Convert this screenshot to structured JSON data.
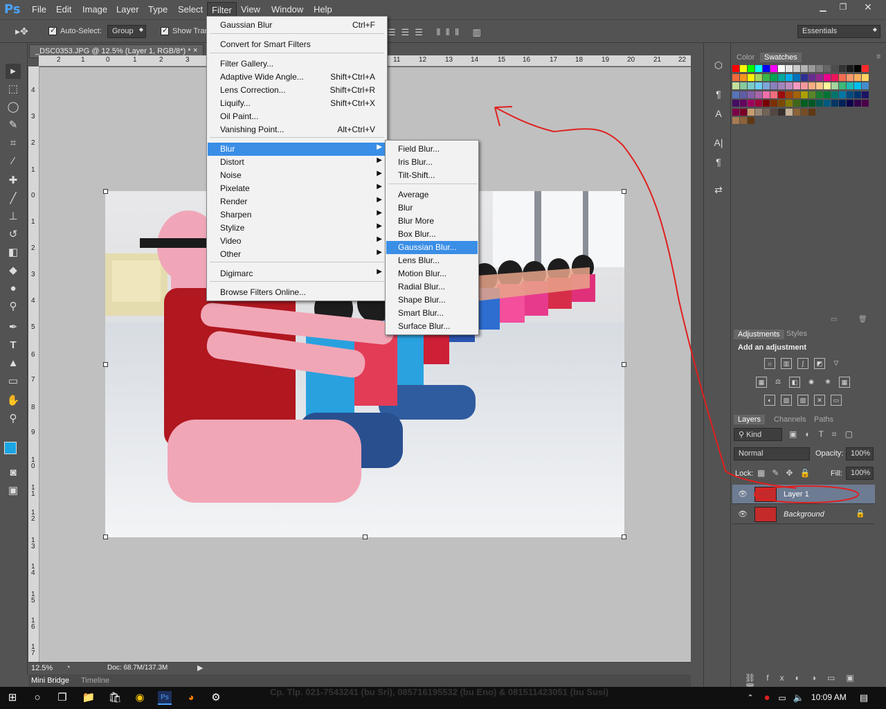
{
  "app": {
    "logo": "Ps"
  },
  "menu": [
    "File",
    "Edit",
    "Image",
    "Layer",
    "Type",
    "Select",
    "Filter",
    "View",
    "Window",
    "Help"
  ],
  "options": {
    "auto_select": "Auto-Select:",
    "group": "Group",
    "show_transform": "Show Tran",
    "workspace": "Essentials"
  },
  "document": {
    "tab_title": "_DSC0353.JPG @ 12.5% (Layer 1, RGB/8*) *",
    "close": "×"
  },
  "ruler_h": [
    "2",
    "1",
    "0",
    "1",
    "2",
    "3",
    "11",
    "12",
    "13",
    "14",
    "15",
    "16",
    "17",
    "18",
    "19",
    "20",
    "21",
    "22"
  ],
  "ruler_v": [
    "4",
    "3",
    "2",
    "1",
    "0",
    "1",
    "2",
    "3",
    "4",
    "5",
    "6",
    "7",
    "8",
    "9",
    "1 0",
    "1 1",
    "1 2",
    "1 3",
    "1 4",
    "1 5",
    "1 6",
    "1 7"
  ],
  "filter_menu": {
    "items": [
      {
        "label": "Gaussian Blur",
        "shortcut": "Ctrl+F"
      },
      {
        "label": "Convert for Smart Filters",
        "shortcut": ""
      },
      {
        "label": "Filter Gallery...",
        "shortcut": ""
      },
      {
        "label": "Adaptive Wide Angle...",
        "shortcut": "Shift+Ctrl+A"
      },
      {
        "label": "Lens Correction...",
        "shortcut": "Shift+Ctrl+R"
      },
      {
        "label": "Liquify...",
        "shortcut": "Shift+Ctrl+X"
      },
      {
        "label": "Oil Paint...",
        "shortcut": ""
      },
      {
        "label": "Vanishing Point...",
        "shortcut": "Alt+Ctrl+V"
      },
      {
        "label": "Blur",
        "shortcut": ""
      },
      {
        "label": "Distort",
        "shortcut": ""
      },
      {
        "label": "Noise",
        "shortcut": ""
      },
      {
        "label": "Pixelate",
        "shortcut": ""
      },
      {
        "label": "Render",
        "shortcut": ""
      },
      {
        "label": "Sharpen",
        "shortcut": ""
      },
      {
        "label": "Stylize",
        "shortcut": ""
      },
      {
        "label": "Video",
        "shortcut": ""
      },
      {
        "label": "Other",
        "shortcut": ""
      },
      {
        "label": "Digimarc",
        "shortcut": ""
      },
      {
        "label": "Browse Filters Online...",
        "shortcut": ""
      }
    ]
  },
  "blur_menu": [
    "Field Blur...",
    "Iris Blur...",
    "Tilt-Shift...",
    "Average",
    "Blur",
    "Blur More",
    "Box Blur...",
    "Gaussian Blur...",
    "Lens Blur...",
    "Motion Blur...",
    "Radial Blur...",
    "Shape Blur...",
    "Smart Blur...",
    "Surface Blur..."
  ],
  "status": {
    "zoom": "12.5%",
    "doc": "Doc: 68.7M/137.3M"
  },
  "bottom_tabs": [
    "Mini Bridge",
    "Timeline"
  ],
  "panels": {
    "color_tabs": [
      "Color",
      "Swatches"
    ],
    "adjust_tabs": [
      "Adjustments",
      "Styles"
    ],
    "add_adjustment": "Add an adjustment",
    "layer_tabs": [
      "Layers",
      "Channels",
      "Paths"
    ],
    "kind": "Kind",
    "blend": "Normal",
    "opacity_label": "Opacity:",
    "opacity": "100%",
    "lock_label": "Lock:",
    "fill_label": "Fill:",
    "fill": "100%",
    "layers": [
      {
        "name": "Layer 1"
      },
      {
        "name": "Background"
      }
    ]
  },
  "taskbar": {
    "time": "10:09 AM",
    "ticker": "Cp. Tlp. 021-7543241 (bu Sri), 085716195532 (bu Eno) & 081511423051 (bu Susi)"
  },
  "colors": {
    "accent": "#3a8ee6",
    "annotation": "#e0201e",
    "fg_swatch": "#1ba6e3"
  }
}
